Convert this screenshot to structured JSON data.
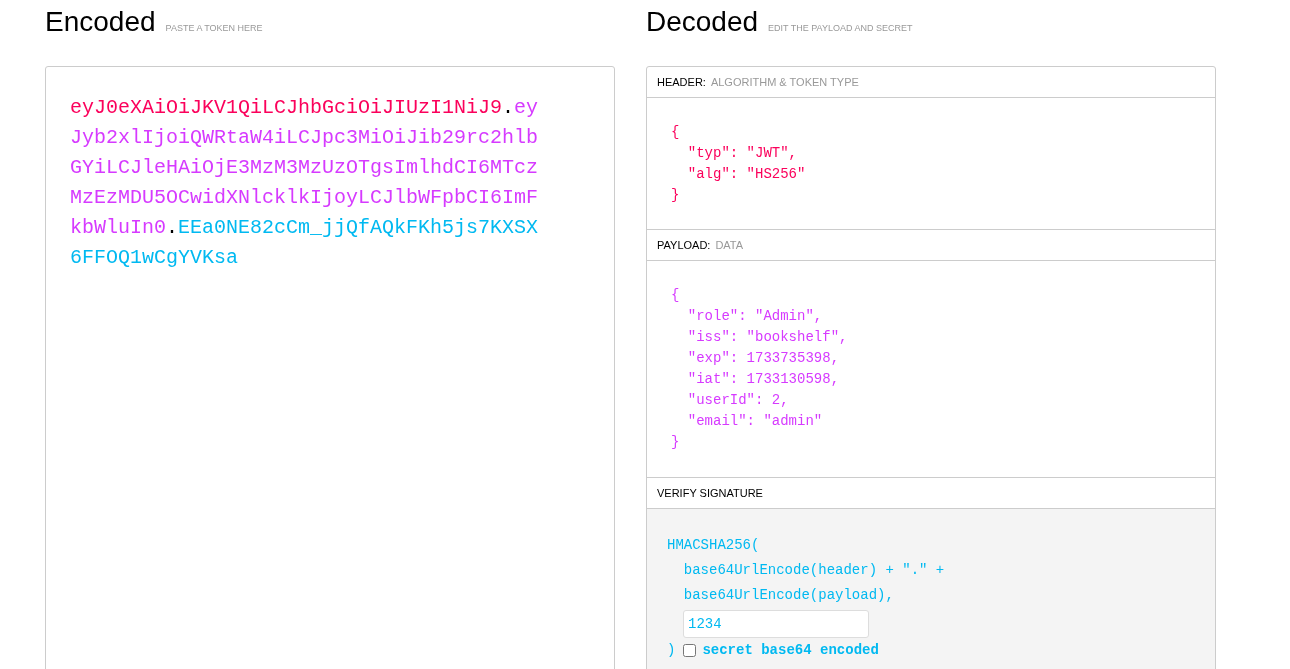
{
  "encoded": {
    "title": "Encoded",
    "subtitle": "PASTE A TOKEN HERE",
    "token": [
      {
        "kind": "header",
        "text": "eyJ0eXAiOiJKV1QiLCJhbGciOiJIUzI1NiJ9"
      },
      {
        "kind": "dot",
        "text": "."
      },
      {
        "kind": "payload",
        "text": "eyJyb2xlIjoiQWRtaW4iLCJpc3MiOiJib29rc2hlbGYiLCJleHAiOjE3MzM3MzUzOTgsImlhdCI6MTczMzEzMDU5OCwidXNlcklkIjoyLCJlbWFpbCI6ImFkbWluIn0"
      },
      {
        "kind": "dot",
        "text": "."
      },
      {
        "kind": "signature",
        "text": "EEa0NE82cCm_jjQfAQkFKh5js7KXSX6FFOQ1wCgYVKsa"
      }
    ]
  },
  "decoded": {
    "title": "Decoded",
    "subtitle": "EDIT THE PAYLOAD AND SECRET",
    "header": {
      "label": "HEADER:",
      "hint": "ALGORITHM & TOKEN TYPE",
      "lines": [
        "{",
        "  \"typ\": \"JWT\",",
        "  \"alg\": \"HS256\"",
        "}"
      ]
    },
    "payload": {
      "label": "PAYLOAD:",
      "hint": "DATA",
      "lines": [
        "{",
        "  \"role\": \"Admin\",",
        "  \"iss\": \"bookshelf\",",
        "  \"exp\": 1733735398,",
        "  \"iat\": 1733130598,",
        "  \"userId\": 2,",
        "  \"email\": \"admin\"",
        "}"
      ]
    },
    "signature": {
      "label": "VERIFY SIGNATURE",
      "lines": [
        "HMACSHA256(",
        "  base64UrlEncode(header) + \".\" +",
        "  base64UrlEncode(payload),"
      ],
      "secret": "1234",
      "close": ")",
      "base64_checkbox": {
        "label": "secret base64 encoded",
        "checked": false
      }
    }
  }
}
